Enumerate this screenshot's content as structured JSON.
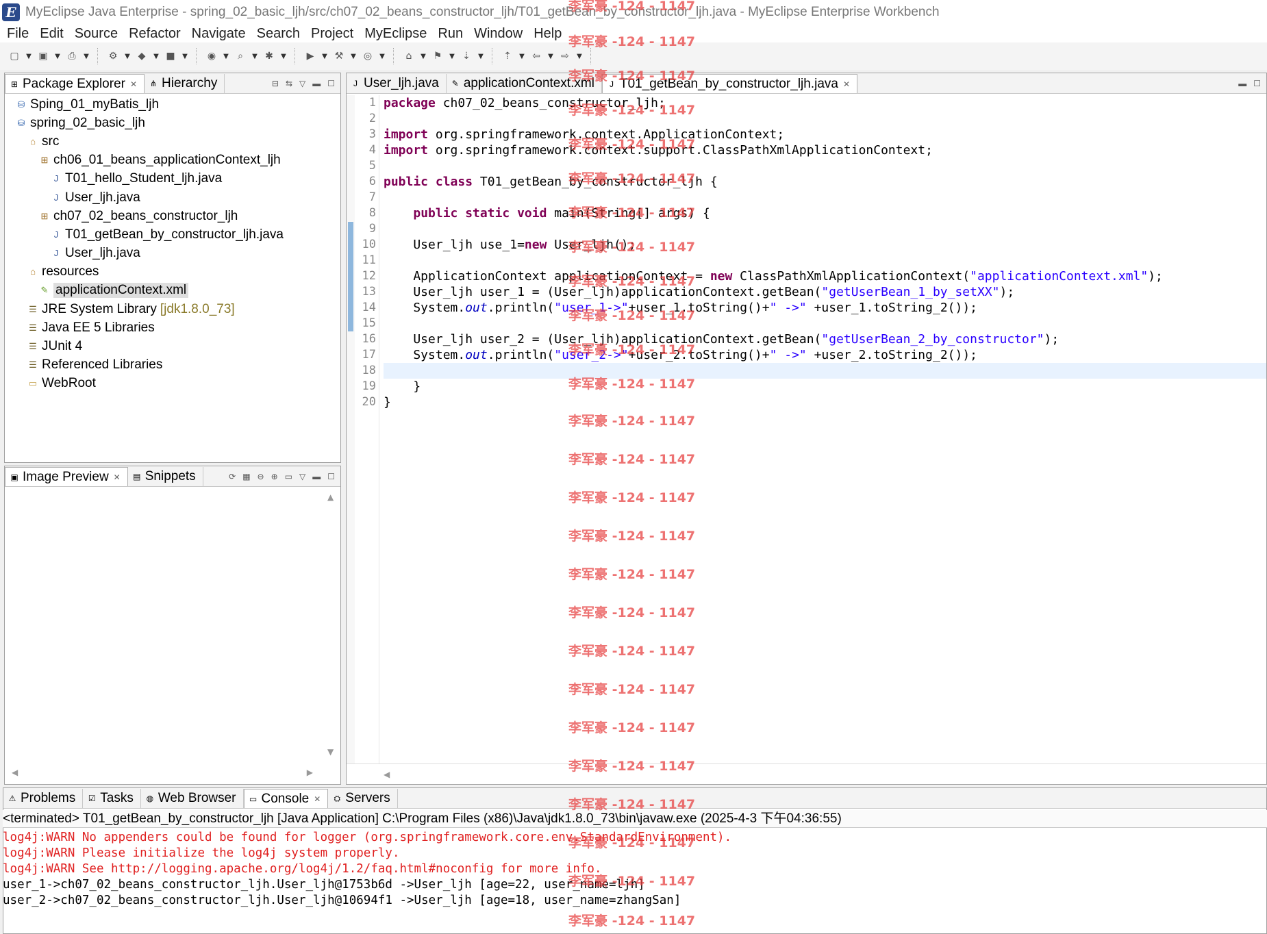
{
  "window": {
    "title": "MyEclipse Java Enterprise - spring_02_basic_ljh/src/ch07_02_beans_constructor_ljh/T01_getBean_by_constructor_ljh.java - MyEclipse Enterprise Workbench"
  },
  "menu": [
    "File",
    "Edit",
    "Source",
    "Refactor",
    "Navigate",
    "Search",
    "Project",
    "MyEclipse",
    "Run",
    "Window",
    "Help"
  ],
  "explorer": {
    "tabs": [
      "Package Explorer",
      "Hierarchy"
    ],
    "items": [
      {
        "label": "Sping_01_myBatis_ljh",
        "indent": 0,
        "icon": "project-icon"
      },
      {
        "label": "spring_02_basic_ljh",
        "indent": 0,
        "icon": "project-icon"
      },
      {
        "label": "src",
        "indent": 1,
        "icon": "source-folder-icon"
      },
      {
        "label": "ch06_01_beans_applicationContext_ljh",
        "indent": 2,
        "icon": "package-icon"
      },
      {
        "label": "T01_hello_Student_ljh.java",
        "indent": 3,
        "icon": "java-file-icon"
      },
      {
        "label": "User_ljh.java",
        "indent": 3,
        "icon": "java-file-icon"
      },
      {
        "label": "ch07_02_beans_constructor_ljh",
        "indent": 2,
        "icon": "package-icon"
      },
      {
        "label": "T01_getBean_by_constructor_ljh.java",
        "indent": 3,
        "icon": "java-file-icon"
      },
      {
        "label": "User_ljh.java",
        "indent": 3,
        "icon": "java-file-icon"
      },
      {
        "label": "resources",
        "indent": 1,
        "icon": "source-folder-icon"
      },
      {
        "label": "applicationContext.xml",
        "indent": 2,
        "icon": "xml-file-icon",
        "selected": true
      },
      {
        "label": "JRE System Library",
        "indent": 1,
        "icon": "library-icon",
        "suffix": "[jdk1.8.0_73]"
      },
      {
        "label": "Java EE 5 Libraries",
        "indent": 1,
        "icon": "library-icon"
      },
      {
        "label": "JUnit 4",
        "indent": 1,
        "icon": "library-icon"
      },
      {
        "label": "Referenced Libraries",
        "indent": 1,
        "icon": "library-icon"
      },
      {
        "label": "WebRoot",
        "indent": 1,
        "icon": "folder-icon"
      }
    ]
  },
  "preview": {
    "tabs": [
      "Image Preview",
      "Snippets"
    ]
  },
  "editor": {
    "tabs": [
      {
        "label": "User_ljh.java",
        "active": false
      },
      {
        "label": "applicationContext.xml",
        "active": false
      },
      {
        "label": "T01_getBean_by_constructor_ljh.java",
        "active": true
      }
    ],
    "lines": [
      {
        "n": "1",
        "parts": [
          [
            "kw",
            "package"
          ],
          [
            "",
            "ch07_02_beans_constructor_ljh;"
          ]
        ]
      },
      {
        "n": "2",
        "parts": []
      },
      {
        "n": "3",
        "parts": [
          [
            "kw",
            "import"
          ],
          [
            "",
            " org.springframework.context.ApplicationContext;"
          ]
        ]
      },
      {
        "n": "4",
        "parts": [
          [
            "kw",
            "import"
          ],
          [
            "",
            " org.springframework.context.support.ClassPathXmlApplicationContext;"
          ]
        ]
      },
      {
        "n": "5",
        "parts": []
      },
      {
        "n": "6",
        "parts": [
          [
            "kw",
            "public class"
          ],
          [
            "",
            " T01_getBean_by_constructor_ljh {"
          ]
        ]
      },
      {
        "n": "7",
        "parts": []
      },
      {
        "n": "8",
        "parts": [
          [
            "",
            "    "
          ],
          [
            "kw",
            "public static void"
          ],
          [
            "",
            " main(String[] args) {"
          ]
        ]
      },
      {
        "n": "9",
        "parts": []
      },
      {
        "n": "10",
        "parts": [
          [
            "",
            "    User_ljh use_1="
          ],
          [
            "kw",
            "new"
          ],
          [
            "",
            " User_ljh();"
          ]
        ]
      },
      {
        "n": "11",
        "parts": []
      },
      {
        "n": "12",
        "parts": [
          [
            "",
            "    ApplicationContext applicationContext = "
          ],
          [
            "kw",
            "new"
          ],
          [
            "",
            " ClassPathXmlApplicationContext("
          ],
          [
            "str",
            "\"applicationContext.xml\""
          ],
          [
            "",
            ");"
          ]
        ]
      },
      {
        "n": "13",
        "parts": [
          [
            "",
            "    User_ljh user_1 = (User_ljh)applicationContext.getBean("
          ],
          [
            "str",
            "\"getUserBean_1_by_setXX\""
          ],
          [
            "",
            ");"
          ]
        ]
      },
      {
        "n": "14",
        "parts": [
          [
            "",
            "    System."
          ],
          [
            "it",
            "out"
          ],
          [
            "",
            ".println("
          ],
          [
            "str",
            "\"user_1->\""
          ],
          [
            "",
            "+user_1.toString()+"
          ],
          [
            "str",
            "\" ->\""
          ],
          [
            "",
            " +user_1.toString_2());"
          ]
        ]
      },
      {
        "n": "15",
        "parts": []
      },
      {
        "n": "16",
        "parts": [
          [
            "",
            "    User_ljh user_2 = (User_ljh)applicationContext.getBean("
          ],
          [
            "str",
            "\"getUserBean_2_by_constructor\""
          ],
          [
            "",
            ");"
          ]
        ]
      },
      {
        "n": "17",
        "parts": [
          [
            "",
            "    System."
          ],
          [
            "it",
            "out"
          ],
          [
            "",
            ".println("
          ],
          [
            "str",
            "\"user_2->\""
          ],
          [
            "",
            "+user_2.toString()+"
          ],
          [
            "str",
            "\" ->\""
          ],
          [
            "",
            " +user_2.toString_2());"
          ]
        ]
      },
      {
        "n": "18",
        "parts": [],
        "current": true
      },
      {
        "n": "19",
        "parts": [
          [
            "",
            "    }"
          ]
        ]
      },
      {
        "n": "20",
        "parts": [
          [
            "",
            "}"
          ]
        ]
      }
    ]
  },
  "console": {
    "tabs": [
      "Problems",
      "Tasks",
      "Web Browser",
      "Console",
      "Servers"
    ],
    "header": "<terminated> T01_getBean_by_constructor_ljh [Java Application] C:\\Program Files (x86)\\Java\\jdk1.8.0_73\\bin\\javaw.exe (2025-4-3 下午04:36:55)",
    "lines": [
      {
        "text": "log4j:WARN No appenders could be found for logger (org.springframework.core.env.StandardEnvironment).",
        "err": true
      },
      {
        "text": "log4j:WARN Please initialize the log4j system properly.",
        "err": true
      },
      {
        "text": "log4j:WARN See http://logging.apache.org/log4j/1.2/faq.html#noconfig for more info.",
        "err": true
      },
      {
        "text": "user_1->ch07_02_beans_constructor_ljh.User_ljh@1753b6d ->User_ljh [age=22, user_name=ljh]",
        "err": false
      },
      {
        "text": "user_2->ch07_02_beans_constructor_ljh.User_ljh@10694f1 ->User_ljh [age=18, user_name=zhangSan]",
        "err": false
      }
    ]
  },
  "watermark": {
    "text": "李军豪 -124 - 1147"
  }
}
